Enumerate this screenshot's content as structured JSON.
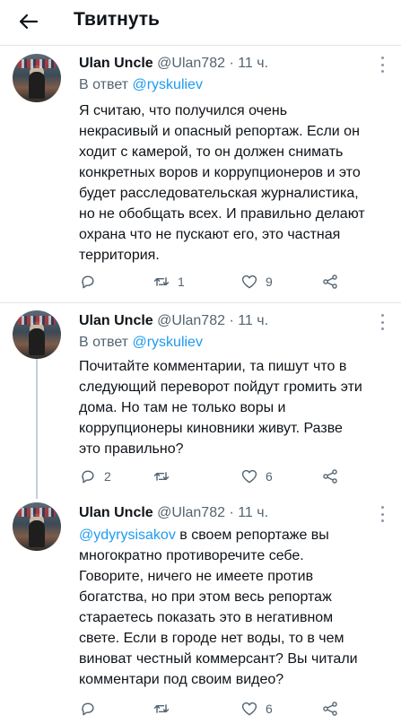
{
  "header": {
    "title": "Твитнуть"
  },
  "tweets": [
    {
      "author_name": "Ulan Uncle",
      "handle": "@Ulan782",
      "separator": "·",
      "time": "11 ч.",
      "reply_prefix": "В ответ",
      "reply_to": "@ryskuliev",
      "mention": "",
      "text": "Я считаю, что получился очень\nнекрасивый и опасный репортаж. Если он\nходит с камерой, то он должен снимать\nконкретных воров и коррупционеров и это\nбудет расследовательская журналистика,\nно не обобщать всех. И правильно делают\nохрана  что не пускают его, это частная\nтерритория.",
      "reply_count": "",
      "retweet_count": "1",
      "like_count": "9"
    },
    {
      "author_name": "Ulan Uncle",
      "handle": "@Ulan782",
      "separator": "·",
      "time": "11 ч.",
      "reply_prefix": "В ответ",
      "reply_to": "@ryskuliev",
      "mention": "",
      "text": "Почитайте комментарии,  та  пишут что в\nследующий переворот пойдут громить эти\nдома. Но там не только воры и\nкоррупционеры киновники живут.  Разве\nэто правильно?",
      "reply_count": "2",
      "retweet_count": "",
      "like_count": "6"
    },
    {
      "author_name": "Ulan Uncle",
      "handle": "@Ulan782",
      "separator": "·",
      "time": "11 ч.",
      "reply_prefix": "",
      "reply_to": "",
      "mention": "@ydyrysisakov",
      "text": " в своем репортаже вы\nмногократно противоречите себе.\nГоворите, ничего не имеете против\nбогатства, но при этом весь репортаж\nстараетесь показать это в негативном\nсвете. Если в городе нет воды, то в чем\nвиноват честный коммерсант? Вы читали\nкомментари под своим видео?",
      "reply_count": "",
      "retweet_count": "",
      "like_count": "6"
    }
  ],
  "icons": {
    "back": "arrow-left-icon",
    "reply": "reply-icon",
    "retweet": "retweet-icon",
    "like": "heart-icon",
    "share": "share-icon",
    "more": "more-vertical-icon"
  },
  "colors": {
    "accent": "#1d9bf0",
    "secondary_text": "#536471",
    "divider": "#e1e6ea"
  }
}
